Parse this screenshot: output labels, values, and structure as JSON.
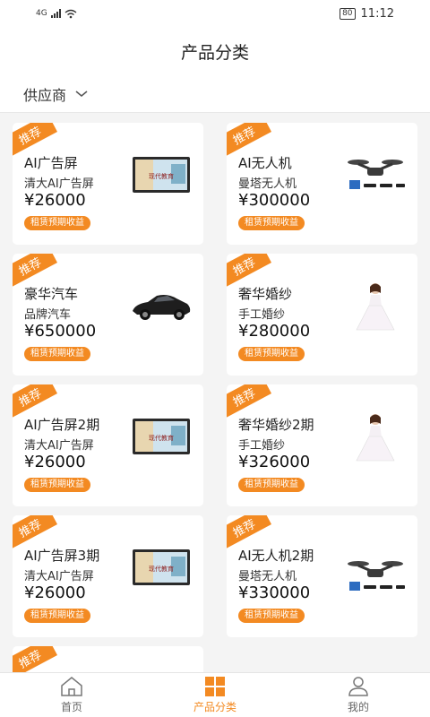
{
  "status_bar": {
    "network": "4G",
    "battery": "80",
    "time": "11:12"
  },
  "header": {
    "title": "产品分类"
  },
  "filter": {
    "label": "供应商"
  },
  "badge_label": "推荐",
  "products": [
    {
      "title": "AI广告屏",
      "subtitle": "清大AI广告屏",
      "price": "¥26000",
      "button": "租赁预期收益",
      "image": "ad-screen-image"
    },
    {
      "title": "AI无人机",
      "subtitle": "曼塔无人机",
      "price": "¥300000",
      "button": "租赁预期收益",
      "image": "drone-image"
    },
    {
      "title": "豪华汽车",
      "subtitle": "品牌汽车",
      "price": "¥650000",
      "button": "租赁预期收益",
      "image": "car-image"
    },
    {
      "title": "奢华婚纱",
      "subtitle": "手工婚纱",
      "price": "¥280000",
      "button": "租赁预期收益",
      "image": "wedding-dress-image"
    },
    {
      "title": "AI广告屏2期",
      "subtitle": "清大AI广告屏",
      "price": "¥26000",
      "button": "租赁预期收益",
      "image": "ad-screen-image"
    },
    {
      "title": "奢华婚纱2期",
      "subtitle": "手工婚纱",
      "price": "¥326000",
      "button": "租赁预期收益",
      "image": "wedding-dress-image"
    },
    {
      "title": "AI广告屏3期",
      "subtitle": "清大AI广告屏",
      "price": "¥26000",
      "button": "租赁预期收益",
      "image": "ad-screen-image"
    },
    {
      "title": "AI无人机2期",
      "subtitle": "曼塔无人机",
      "price": "¥330000",
      "button": "租赁预期收益",
      "image": "drone-image"
    }
  ],
  "ad_screen_text": "现代教育",
  "tabs": [
    {
      "label": "首页",
      "icon": "home-icon",
      "active": false
    },
    {
      "label": "产品分类",
      "icon": "grid-icon",
      "active": true
    },
    {
      "label": "我的",
      "icon": "user-icon",
      "active": false
    }
  ],
  "colors": {
    "accent": "#f38a22",
    "background": "#f4f4f4"
  }
}
